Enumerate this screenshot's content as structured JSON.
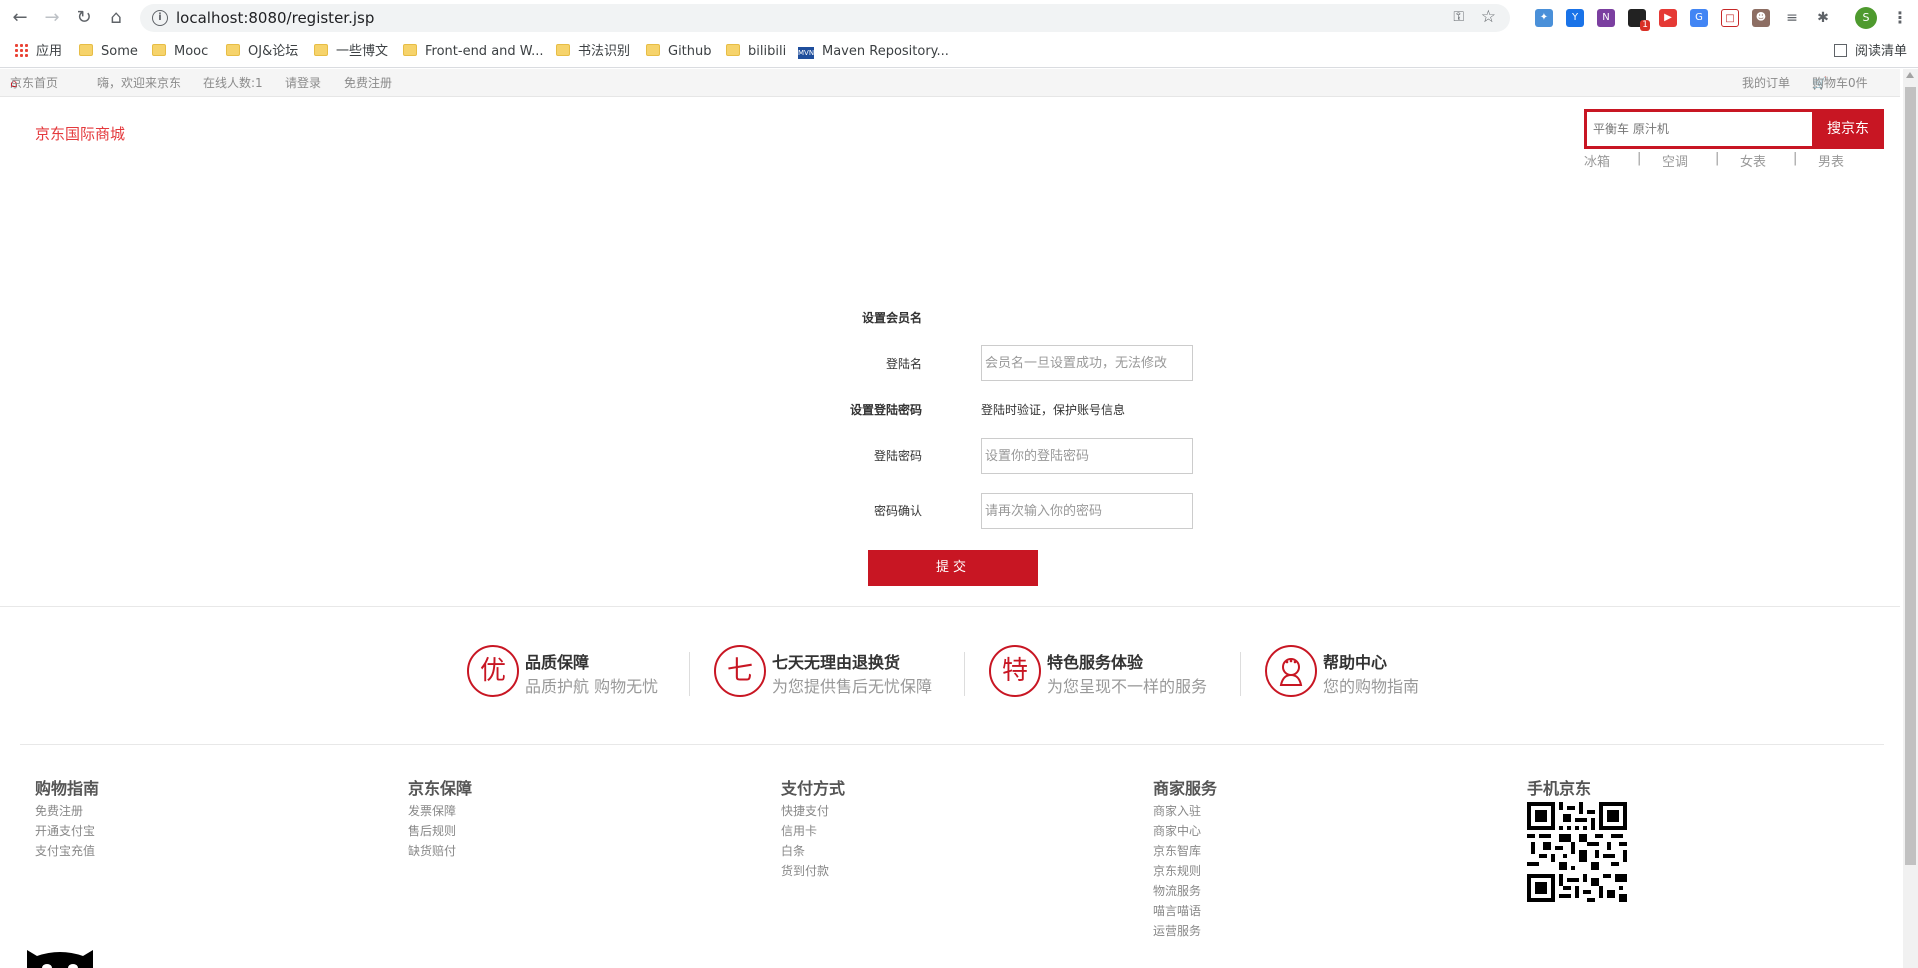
{
  "browser": {
    "url": "localhost:8080/register.jsp",
    "bookmarks": [
      {
        "label": "应用",
        "icon": "apps-grid-icon"
      },
      {
        "label": "Some",
        "icon": "folder-icon"
      },
      {
        "label": "Mooc",
        "icon": "folder-icon"
      },
      {
        "label": "OJ&论坛",
        "icon": "folder-icon"
      },
      {
        "label": "一些博文",
        "icon": "folder-icon"
      },
      {
        "label": "Front-end and W...",
        "icon": "folder-icon"
      },
      {
        "label": "书法识别",
        "icon": "folder-icon"
      },
      {
        "label": "Github",
        "icon": "folder-icon"
      },
      {
        "label": "bilibili",
        "icon": "folder-icon"
      },
      {
        "label": "Maven Repository...",
        "icon": "mvn-icon"
      }
    ],
    "reading_list": "阅读清单",
    "profile_initial": "S",
    "extension_badge": "1"
  },
  "topbar": {
    "home": "京东首页",
    "welcome": "嗨，欢迎来京东",
    "online": "在线人数:1",
    "login": "请登录",
    "register": "免费注册",
    "orders": "我的订单",
    "cart": "购物车0件"
  },
  "header": {
    "logo": "京东国际商城",
    "search_placeholder": "平衡车 原汁机",
    "search_button": "搜京东",
    "hotwords": [
      "冰箱",
      "|",
      "空调",
      "|",
      "女表",
      "|",
      "男表"
    ]
  },
  "form": {
    "section_username": "设置会员名",
    "username_label": "登陆名",
    "username_placeholder": "会员名一旦设置成功，无法修改",
    "section_password": "设置登陆密码",
    "password_hint": "登陆时验证，保护账号信息",
    "password_label": "登陆密码",
    "password_placeholder": "设置你的登陆密码",
    "confirm_label": "密码确认",
    "confirm_placeholder": "请再次输入你的密码",
    "submit": "提交"
  },
  "promises": [
    {
      "glyph": "优",
      "title": "品质保障",
      "subtitle": "品质护航 购物无忧"
    },
    {
      "glyph": "七",
      "title": "七天无理由退换货",
      "subtitle": "为您提供售后无忧保障"
    },
    {
      "glyph": "特",
      "title": "特色服务体验",
      "subtitle": "为您呈现不一样的服务"
    },
    {
      "glyph": "",
      "title": "帮助中心",
      "subtitle": "您的购物指南"
    }
  ],
  "footer": {
    "columns": [
      {
        "title": "购物指南",
        "links": [
          "免费注册",
          "开通支付宝",
          "支付宝充值"
        ]
      },
      {
        "title": "京东保障",
        "links": [
          "发票保障",
          "售后规则",
          "缺货赔付"
        ]
      },
      {
        "title": "支付方式",
        "links": [
          "快捷支付",
          "信用卡",
          "白条",
          "货到付款"
        ]
      },
      {
        "title": "商家服务",
        "links": [
          "商家入驻",
          "商家中心",
          "京东智库",
          "京东规则",
          "物流服务",
          "喵言喵语",
          "运营服务"
        ]
      },
      {
        "title": "手机京东",
        "links": []
      }
    ]
  },
  "colors": {
    "brand_red": "#c81623",
    "logo_red": "#e4393c"
  }
}
